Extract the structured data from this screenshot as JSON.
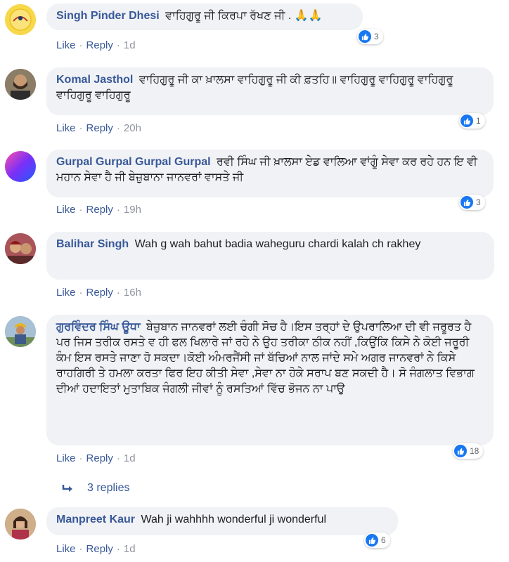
{
  "comments": [
    {
      "author": "Singh Pinder Dhesi",
      "text": "ਵਾਹਿਗੁਰੂ ਜੀ ਕਿਰਪਾ ਰੱਖਣ ਜੀ . 🙏🙏",
      "reactions": "3",
      "like": "Like",
      "reply": "Reply",
      "time": "1d",
      "avatar": "yellow-round-logo"
    },
    {
      "author": "Komal Jasthol",
      "text": "ਵਾਹਿਗੁਰੂ ਜੀ ਕਾ ਖ਼ਾਲਸਾ ਵਾਹਿਗੁਰੂ ਜੀ ਕੀ ਫ਼ਤਹਿ॥ ਵਾਹਿਗੁਰੂ ਵਾਹਿਗੁਰੂ ਵਾਹਿਗੁਰੂ ਵਾਹਿਗੁਰੂ ਵਾਹਿਗੁਰੂ",
      "reactions": "1",
      "like": "Like",
      "reply": "Reply",
      "time": "20h",
      "avatar": "man-portrait"
    },
    {
      "author": "Gurpal Gurpal Gurpal Gurpal",
      "text": "ਰਵੀ ਸਿੰਘ ਜੀ ਖ਼ਾਲਸਾ ਏਡ ਵਾਲਿਆ ਵਾਂਗੂੰ ਸੇਵਾ ਕਰ ਰਹੇ ਹਨ ਇ ਵੀ ਮਹਾਨ ਸੇਵਾ ਹੈ ਜੀ ਬੇਜ਼ੁਬਾਨਾ ਜਾਨਵਰਾਂ ਵਾਸਤੇ ਜੀ",
      "reactions": "3",
      "like": "Like",
      "reply": "Reply",
      "time": "19h",
      "avatar": "purple-gradient"
    },
    {
      "author": "Balihar Singh",
      "text": "Wah g wah bahut badia waheguru chardi kalah ch rakhey",
      "reactions": "",
      "like": "Like",
      "reply": "Reply",
      "time": "16h",
      "avatar": "two-people-photo"
    },
    {
      "author": "ਗੁਰਵਿੰਦਰ ਸਿੰਘ ਊਧਾ",
      "text": "ਬੇਜ਼ੁਬਾਨ ਜਾਨਵਰਾਂ ਲਈ ਚੰਗੀ ਸੋਚ ਹੈ।ਇਸ ਤਰ੍ਹਾਂ ਦੇ ਉਪਰਾਲਿਆ ਦੀ ਵੀ ਜਰੂਰਤ ਹੈ ਪਰ ਜਿਸ ਤਰੀਕ ਰਸਤੇ ਵ ਹੀ ਫਲ ਖਿਲਾਰੇ ਜਾਂ ਰਹੇ ਨੇ ਉਹ ਤਰੀਕਾ ਠੀਕ ਨਹੀਂ ,ਕਿਉਂਕਿ ਕਿਸੇ ਨੇ ਕੋਈ ਜਰੂਰੀ ਕੰਮ ਇਸ ਰਸਤੇ ਜਾਣਾ ਹੋ ਸਕਦਾ।ਕੋਈ ਅੰਮਰਜੈਂਸੀ ਜਾਂ ਬੱਚਿਆਂ ਨਾਲ ਜਾਂਦੇ ਸਮੇ ਅਗਰ ਜਾਨਵਰਾਂ ਨੇ ਕਿਸੇ ਰਾਹਗਿਰੀ ਤੇ ਹਮਲਾ ਕਰਤਾ ਫਿਰ ਇਹ ਕੀਤੀ ਸੇਵਾ ,ਸੇਵਾ ਨਾ ਹੋਕੇ ਸਰਾਪ ਬਣ ਸਕਦੀ ਹੈ। ਸੋ ਜੰਗਲਾਤ ਵਿਭਾਗ ਦੀਆਂ ਹਦਾਇਤਾਂ ਮੁਤਾਬਿਕ ਜੰਗਲੀ ਜੀਵਾਂ ਨੂੰ ਰਸਤਿਆਂ ਵਿੱਚ ਭੋਜਨ ਨਾ ਪਾਉ",
      "reactions": "18",
      "like": "Like",
      "reply": "Reply",
      "time": "1d",
      "avatar": "man-in-turban-outdoors"
    },
    {
      "author": "Manpreet Kaur",
      "text": "Wah ji wahhhh wonderful ji wonderful",
      "reactions": "6",
      "like": "Like",
      "reply": "Reply",
      "time": "1d",
      "avatar": "woman-portrait"
    }
  ],
  "replies_link": "3 replies",
  "colors": {
    "author": "#385898",
    "bubble": "#f0f2f5",
    "like_blue": "#1877f2",
    "meta": "#90949c"
  }
}
